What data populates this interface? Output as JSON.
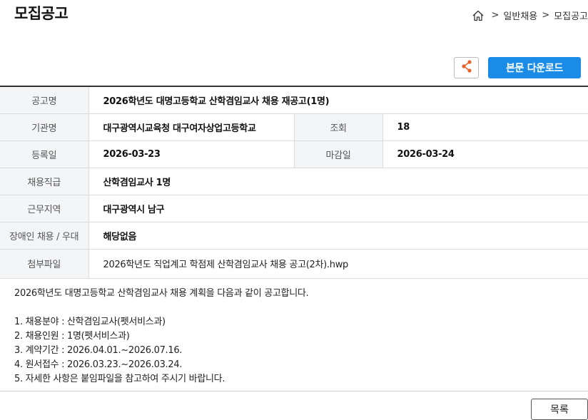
{
  "header": {
    "title": "모집공고",
    "breadcrumb": {
      "home_icon": "home-icon",
      "separator": ">",
      "items": [
        "일반채용",
        "모집공고"
      ]
    }
  },
  "toolbar": {
    "share_icon": "share-icon",
    "download_label": "본문 다운로드",
    "accent_color": "#1a8be6"
  },
  "info": {
    "title_label": "공고명",
    "title_value": "2026학년도 대명고등학교 산학겸임교사 채용 재공고(1명)",
    "org_label": "기관명",
    "org_value": "대구광역시교육청 대구여자상업고등학교",
    "views_label": "조회",
    "views_value": "18",
    "reg_label": "등록일",
    "reg_value": "2026-03-23",
    "deadline_label": "마감일",
    "deadline_value": "2026-03-24",
    "position_label": "채용직급",
    "position_value": "산학겸임교사 1명",
    "region_label": "근무지역",
    "region_value": "대구광역시 남구",
    "disability_label": "장애인 채용 / 우대",
    "disability_value": "해당없음",
    "attachment_label": "첨부파일",
    "attachment_value": "2026학년도 직업계고 학점제 산학겸임교사 채용 공고(2차).hwp"
  },
  "content": {
    "intro": "2026학년도 대명고등학교 산학겸임교사 채용 계획을 다음과 같이 공고합니다.",
    "lines": [
      "1. 채용분야 : 산학겸임교사(펫서비스과)",
      "2. 채용인원 : 1명(펫서비스과)",
      "3. 계약기간 : 2026.04.01.~2026.07.16.",
      "4. 원서접수 : 2026.03.23.~2026.03.24.",
      "5. 자세한 사항은 붙임파일을 참고하여 주시기 바랍니다."
    ]
  },
  "footer": {
    "list_label": "목록"
  }
}
